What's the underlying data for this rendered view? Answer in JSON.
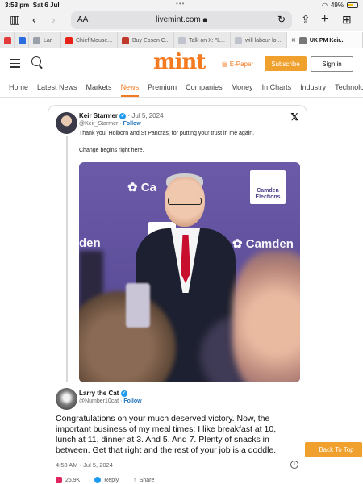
{
  "status_bar": {
    "time": "3:53 pm",
    "date": "Sat 6 Jul",
    "battery": "49%",
    "battery_level": 0.49
  },
  "browser": {
    "url": "livemint.com",
    "text_size_label": "AA",
    "tabs": [
      {
        "label": "",
        "color": "#e23b3b"
      },
      {
        "label": "",
        "color": "#2d6cdf"
      },
      {
        "label": "Lar",
        "color": "#9aa0aa"
      },
      {
        "label": "Chief Mouse...",
        "color": "#e62117"
      },
      {
        "label": "Buy Epson C...",
        "color": "#c0392b"
      },
      {
        "label": "Talk on X: \"L...",
        "color": "#bfc4cc"
      },
      {
        "label": "will labour lo...",
        "color": "#bfc4cc"
      },
      {
        "label": "UK PM Keir...",
        "color": "#777777",
        "active": true
      }
    ]
  },
  "site": {
    "logo": "mint",
    "epaper": "E-Paper",
    "subscribe": "Subscribe",
    "signin": "Sign in",
    "nav": [
      "Home",
      "Latest News",
      "Markets",
      "News",
      "Premium",
      "Companies",
      "Money",
      "In Charts",
      "Industry",
      "Technology"
    ],
    "active_nav": "News",
    "accent": "#f47a20"
  },
  "tweet1": {
    "name": "Keir Starmer",
    "date": "· Jul 5, 2024",
    "handle": "@Keir_Starmer",
    "follow": "Follow",
    "text": "Thank you, Holborn and St Pancras, for putting your trust in me again.",
    "text2": "Change begins right here.",
    "photo_brand_1": "Ca",
    "photo_brand_2": "den",
    "photo_brand_3": "Camden",
    "sign_text": "Camden Elections",
    "sign_text_2": "Ca"
  },
  "tweet2": {
    "name": "Larry the Cat",
    "handle": "@Number10cat",
    "follow": "Follow",
    "text": "Congratulations on your much deserved victory. Now, the important business of my meal times: I like breakfast at 10, lunch at 11, dinner at 3. And 5. And 7. Plenty of snacks in between. Get that right and the rest of your job is a doddle.",
    "meta": "4:58 AM · Jul 5, 2024",
    "likes": "25.9K",
    "reply": "Reply",
    "share": "Share"
  },
  "back_to_top": "Back To Top"
}
